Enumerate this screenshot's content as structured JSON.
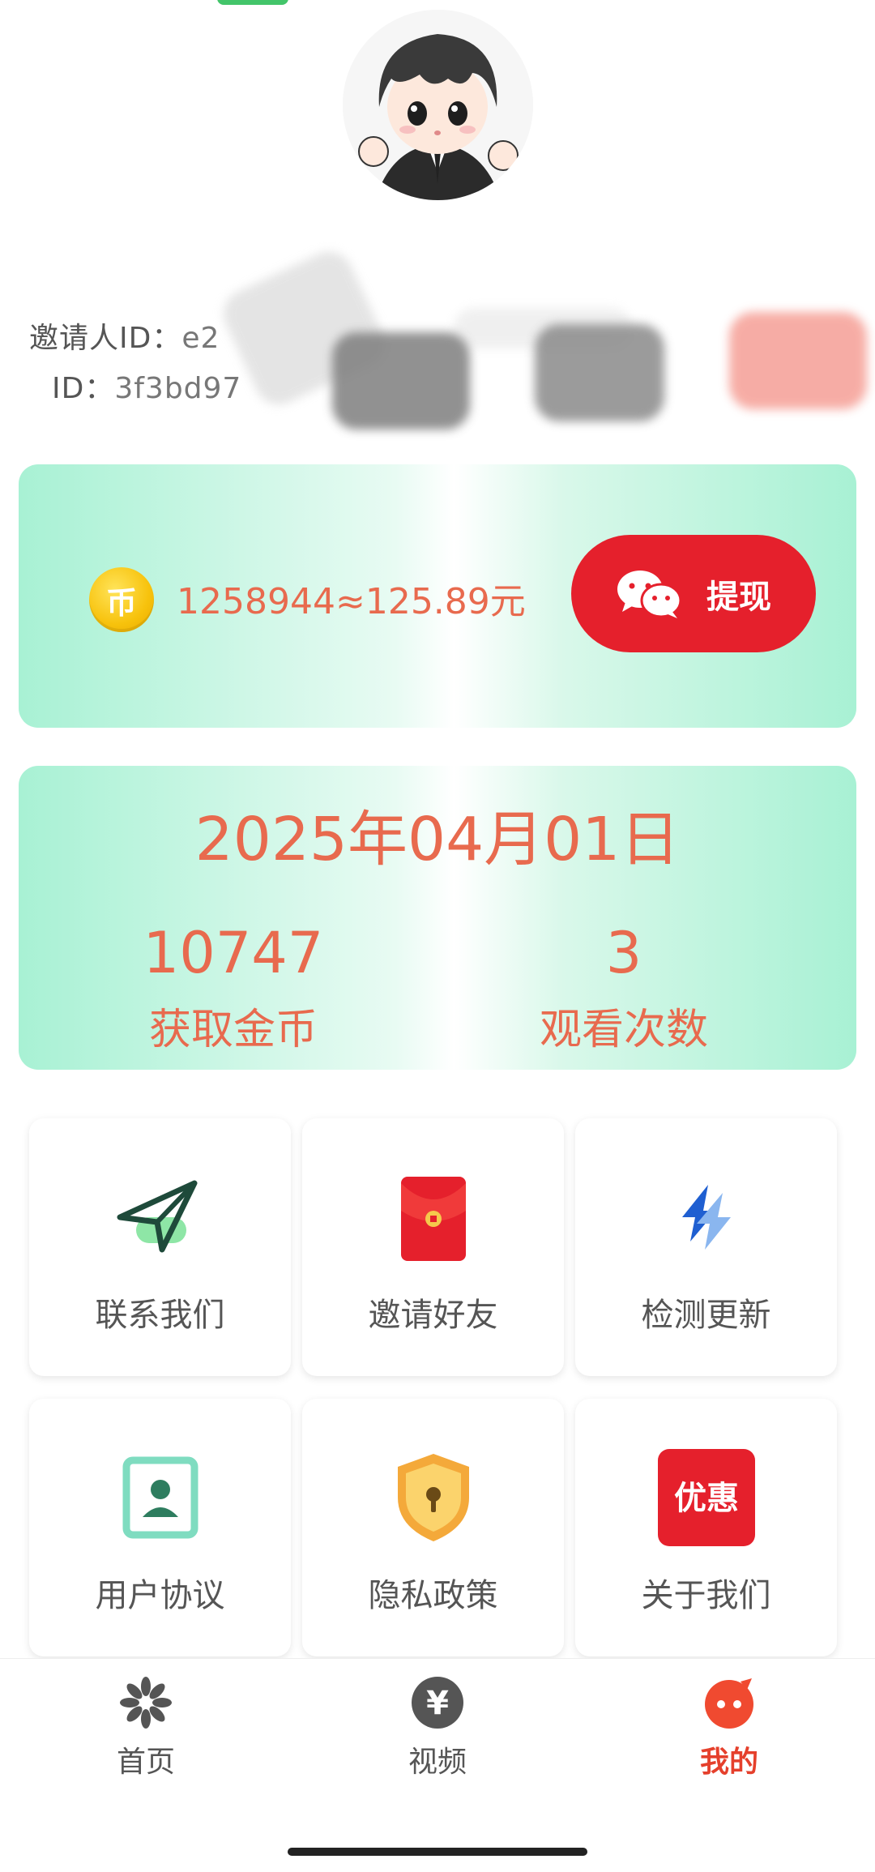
{
  "profile": {
    "inviter_label": "邀请人ID：",
    "inviter_value": "e2",
    "id_label": "ID：",
    "id_value": "3f3bd97"
  },
  "balance": {
    "coin_glyph": "币",
    "text": "1258944≈125.89元",
    "withdraw_label": "提现"
  },
  "stats": {
    "date": "2025年04月01日",
    "coins_value": "10747",
    "coins_label": "获取金币",
    "views_value": "3",
    "views_label": "观看次数"
  },
  "grid": [
    {
      "label": "联系我们",
      "icon": "paper-plane-icon"
    },
    {
      "label": "邀请好友",
      "icon": "red-envelope-icon"
    },
    {
      "label": "检测更新",
      "icon": "refresh-arrows-icon"
    },
    {
      "label": "用户协议",
      "icon": "user-document-icon"
    },
    {
      "label": "隐私政策",
      "icon": "shield-lock-icon"
    },
    {
      "label": "关于我们",
      "icon": "promo-badge-icon",
      "badge_text": "优惠"
    }
  ],
  "nav": [
    {
      "label": "首页",
      "icon": "flower-icon",
      "active": false
    },
    {
      "label": "视频",
      "icon": "yen-coin-icon",
      "glyph": "¥",
      "active": false
    },
    {
      "label": "我的",
      "icon": "chat-bubble-icon",
      "active": true
    }
  ],
  "colors": {
    "accent_text": "#e86a4e",
    "withdraw_button": "#e5202c",
    "card_gradient_edge": "#a8f1d4",
    "nav_active": "#e5402c"
  }
}
